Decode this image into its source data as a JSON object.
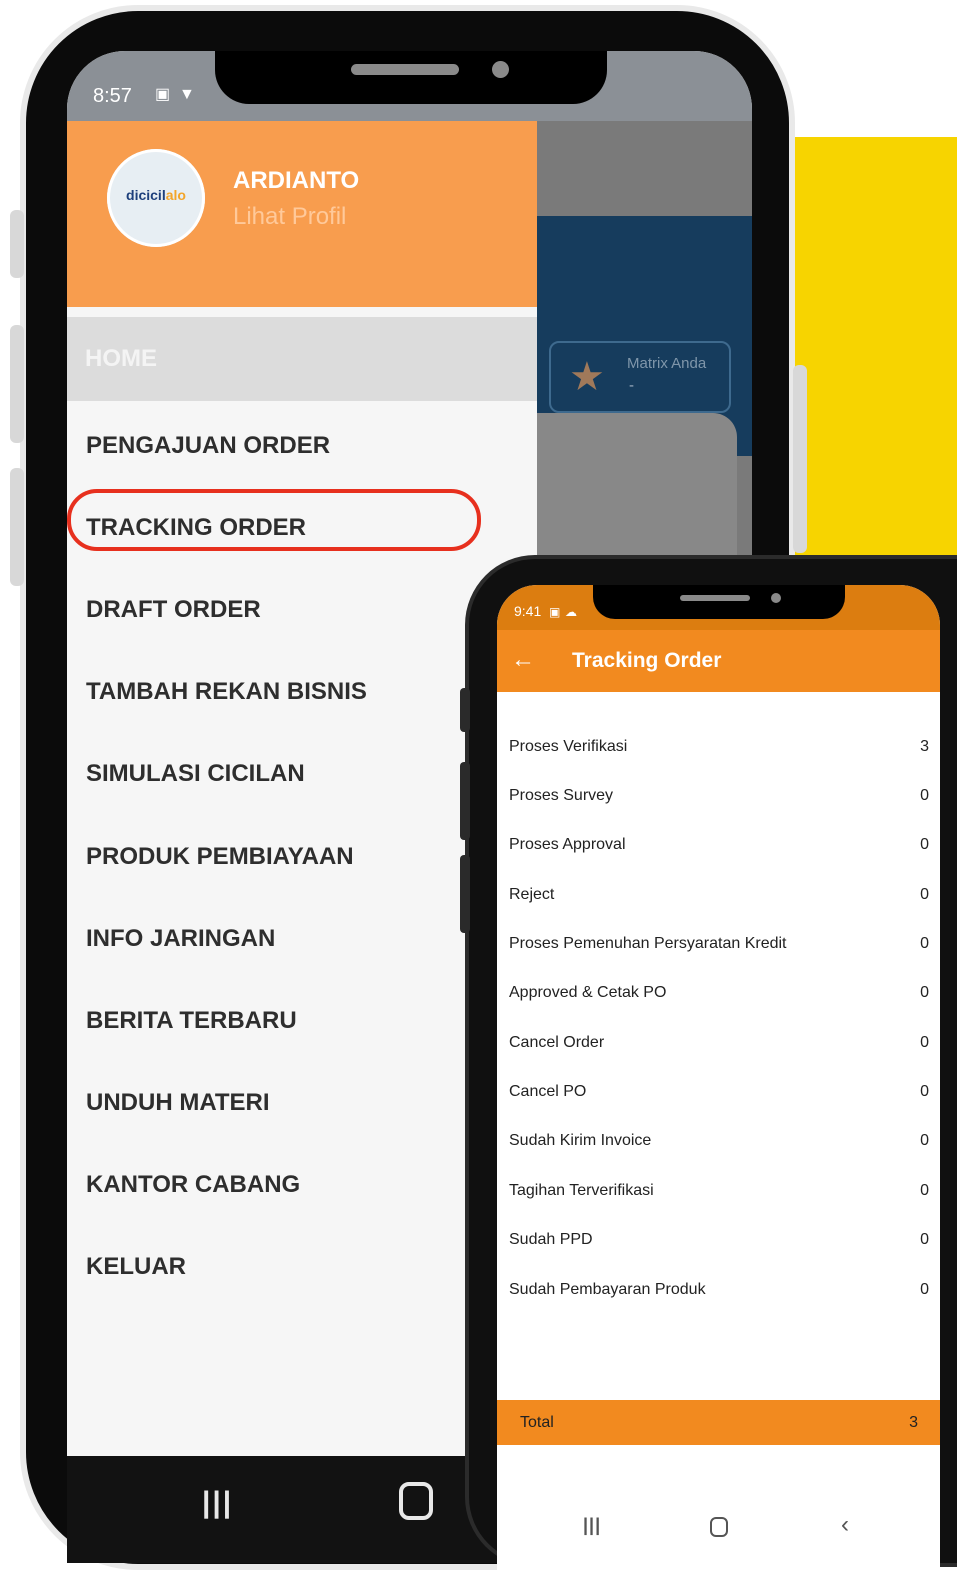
{
  "drawer": {
    "status_time": "8:57",
    "user_name": "ARDIANTO",
    "profile_link": "Lihat Profil",
    "logo_text_main": "dicicil",
    "logo_text_accent": "alo",
    "home_label": "HOME",
    "menu": [
      "PENGAJUAN ORDER",
      "TRACKING ORDER",
      "DRAFT ORDER",
      "TAMBAH REKAN BISNIS",
      "SIMULASI CICILAN",
      "PRODUK PEMBIAYAAN",
      "INFO JARINGAN",
      "BERITA TERBARU",
      "UNDUH MATERI",
      "KANTOR CABANG",
      "KELUAR"
    ]
  },
  "background_app": {
    "matrix_label": "Matrix Anda",
    "matrix_value": "-"
  },
  "tracking": {
    "status_time": "9:41",
    "title": "Tracking Order",
    "rows": [
      {
        "label": "Proses Verifikasi",
        "count": "3"
      },
      {
        "label": "Proses Survey",
        "count": "0"
      },
      {
        "label": "Proses Approval",
        "count": "0"
      },
      {
        "label": "Reject",
        "count": "0"
      },
      {
        "label": "Proses Pemenuhan Persyaratan Kredit",
        "count": "0"
      },
      {
        "label": "Approved & Cetak PO",
        "count": "0"
      },
      {
        "label": "Cancel Order",
        "count": "0"
      },
      {
        "label": "Cancel PO",
        "count": "0"
      },
      {
        "label": "Sudah Kirim Invoice",
        "count": "0"
      },
      {
        "label": "Tagihan Terverifikasi",
        "count": "0"
      },
      {
        "label": "Sudah PPD",
        "count": "0"
      },
      {
        "label": "Sudah Pembayaran Produk",
        "count": "0"
      }
    ],
    "total_label": "Total",
    "total_count": "3"
  },
  "colors": {
    "drawer_header": "#f89d4e",
    "accent_orange": "#f28a1f",
    "highlight_red": "#e7301e",
    "yellow_panel": "#f7d400"
  }
}
